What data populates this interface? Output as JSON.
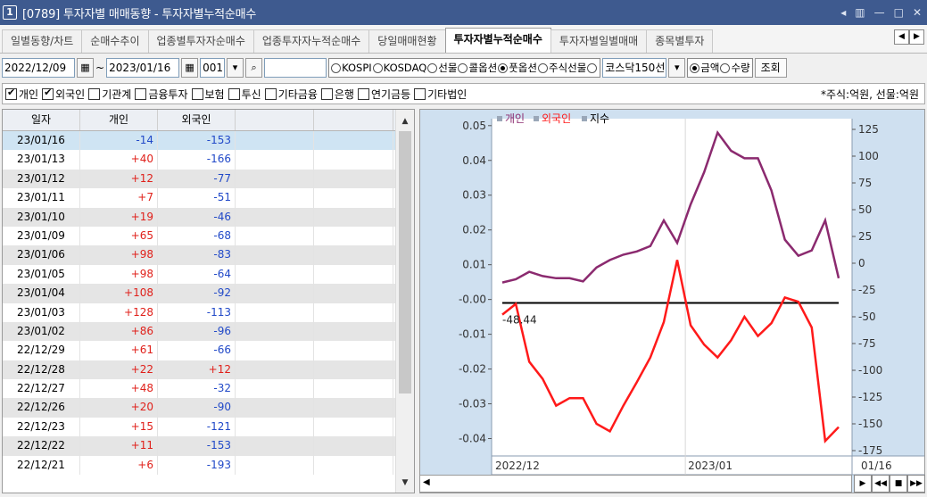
{
  "window": {
    "badge": "1",
    "title": "[0789] 투자자별 매매동향 - 투자자별누적순매수",
    "controls": [
      "◂",
      "▥",
      "—",
      "□",
      "✕"
    ]
  },
  "tabs": [
    "일별동향/차트",
    "순매수추이",
    "업종별투자자순매수",
    "업종투자자누적순매수",
    "당일매매현황",
    "투자자별누적순매수",
    "투자자별일별매매",
    "종목별투자"
  ],
  "active_tab": 5,
  "toolbar": {
    "start_date": "2022/12/09",
    "tilde": "~",
    "end_date": "2023/01/16",
    "code": "001",
    "code_arrow": "▾",
    "search_icon": "⌕",
    "code_name": "",
    "radios": [
      {
        "label": "KOSPI",
        "on": false
      },
      {
        "label": "KOSDAQ",
        "on": false
      },
      {
        "label": "선물",
        "on": false
      },
      {
        "label": "콜옵션",
        "on": false
      },
      {
        "label": "풋옵션",
        "on": true
      },
      {
        "label": "주식선물",
        "on": false
      },
      {
        "label": "",
        "on": false
      }
    ],
    "select_value": "코스닥150선",
    "amount_radios": [
      {
        "label": "금액",
        "on": true
      },
      {
        "label": "수량",
        "on": false
      }
    ],
    "query_button": "조회"
  },
  "filters": [
    {
      "label": "개인",
      "on": true
    },
    {
      "label": "외국인",
      "on": true
    },
    {
      "label": "기관계",
      "on": false
    },
    {
      "label": "금융투자",
      "on": false
    },
    {
      "label": "보험",
      "on": false
    },
    {
      "label": "투신",
      "on": false
    },
    {
      "label": "기타금융",
      "on": false
    },
    {
      "label": "은행",
      "on": false
    },
    {
      "label": "연기금등",
      "on": false
    },
    {
      "label": "기타법인",
      "on": false
    }
  ],
  "unit_note": "*주식:억원, 선물:억원",
  "table": {
    "headers": [
      "일자",
      "개인",
      "외국인",
      "",
      ""
    ],
    "rows": [
      [
        "23/01/16",
        "-14",
        "-153"
      ],
      [
        "23/01/13",
        "+40",
        "-166"
      ],
      [
        "23/01/12",
        "+12",
        "-77"
      ],
      [
        "23/01/11",
        "+7",
        "-51"
      ],
      [
        "23/01/10",
        "+19",
        "-46"
      ],
      [
        "23/01/09",
        "+65",
        "-68"
      ],
      [
        "23/01/06",
        "+98",
        "-83"
      ],
      [
        "23/01/05",
        "+98",
        "-64"
      ],
      [
        "23/01/04",
        "+108",
        "-92"
      ],
      [
        "23/01/03",
        "+128",
        "-113"
      ],
      [
        "23/01/02",
        "+86",
        "-96"
      ],
      [
        "22/12/29",
        "+61",
        "-66"
      ],
      [
        "22/12/28",
        "+22",
        "+12"
      ],
      [
        "22/12/27",
        "+48",
        "-32"
      ],
      [
        "22/12/26",
        "+20",
        "-90"
      ],
      [
        "22/12/23",
        "+15",
        "-121"
      ],
      [
        "22/12/22",
        "+11",
        "-153"
      ],
      [
        "22/12/21",
        "+6",
        "-193"
      ]
    ]
  },
  "chart_data": {
    "type": "line",
    "legend": [
      "개인",
      "외국인",
      "지수"
    ],
    "legend_colors": [
      "#8b2a6f",
      "#ff1a1a",
      "#000000"
    ],
    "left_axis": {
      "ticks": [
        "0.05",
        "0.04",
        "0.03",
        "0.02",
        "0.01",
        "-0.00",
        "-0.01",
        "-0.02",
        "-0.03",
        "-0.04"
      ],
      "range": [
        -0.045,
        0.052
      ]
    },
    "right_axis": {
      "ticks": [
        "125",
        "100",
        "75",
        "50",
        "25",
        "0",
        "-25",
        "-50",
        "-75",
        "-100",
        "-125",
        "-150",
        "-175"
      ],
      "range": [
        -180,
        135
      ]
    },
    "x_labels": [
      "2022/12",
      "2023/01",
      "01/16"
    ],
    "annotation": "-48.44",
    "series": [
      {
        "name": "개인",
        "axis": "right",
        "color": "#8b2a6f",
        "values": [
          -18,
          -15,
          -8,
          -12,
          -14,
          -14,
          -17,
          -4,
          3,
          8,
          11,
          16,
          40,
          19,
          55,
          85,
          122,
          105,
          98,
          98,
          68,
          22,
          7,
          12,
          40,
          -14
        ]
      },
      {
        "name": "외국인",
        "axis": "right",
        "color": "#ff1a1a",
        "values": [
          -48,
          -38,
          -92,
          -108,
          -133,
          -126,
          -126,
          -150,
          -157,
          -133,
          -111,
          -88,
          -55,
          3,
          -58,
          -76,
          -88,
          -72,
          -50,
          -68,
          -56,
          -32,
          -36,
          -60,
          -166,
          -153
        ]
      },
      {
        "name": "지수",
        "axis": "left",
        "color": "#000000",
        "values": [
          -0.001,
          -0.001
        ]
      }
    ]
  }
}
